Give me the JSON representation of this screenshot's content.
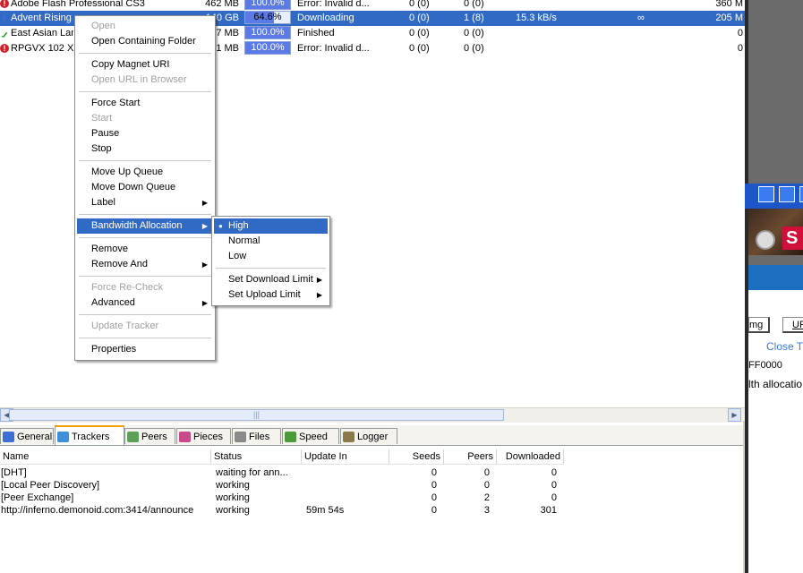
{
  "torrents": [
    {
      "name": "Adobe Flash Professional CS3",
      "size": "462 MB",
      "done": "100.0%",
      "done_pct": 100,
      "status": "Error: Invalid d...",
      "seeds": "0 (0)",
      "peers": "0 (0)",
      "speed": "",
      "eta": "",
      "uploaded": "360 M",
      "icon": "error-icon",
      "icon_glyph": "!"
    },
    {
      "name": "Advent Rising",
      "size": "140 GB",
      "done": "64.6%",
      "done_pct": 64.6,
      "status": "Downloading",
      "seeds": "0 (0)",
      "peers": "1 (8)",
      "speed": "15.3 kB/s",
      "eta": "∞",
      "uploaded": "205 M",
      "icon": "download-arrow-icon",
      "icon_glyph": "⬇",
      "selected": true
    },
    {
      "name": "East Asian Lan",
      "size": "17 MB",
      "done": "100.0%",
      "done_pct": 100,
      "status": "Finished",
      "seeds": "0 (0)",
      "peers": "0 (0)",
      "speed": "",
      "eta": "",
      "uploaded": "0",
      "icon": "checkmark-icon",
      "icon_glyph": "✓"
    },
    {
      "name": "RPGVX 102 XW",
      "size": ".1 MB",
      "done": "100.0%",
      "done_pct": 100,
      "status": "Error: Invalid d...",
      "seeds": "0 (0)",
      "peers": "0 (0)",
      "speed": "",
      "eta": "",
      "uploaded": "0",
      "icon": "error-icon",
      "icon_glyph": "!"
    }
  ],
  "context_menu": {
    "items": [
      {
        "label": "Open",
        "enabled": false
      },
      {
        "label": "Open Containing Folder",
        "enabled": true
      },
      {
        "sep": true
      },
      {
        "label": "Copy Magnet URI",
        "enabled": true
      },
      {
        "label": "Open URL in Browser",
        "enabled": false
      },
      {
        "sep": true
      },
      {
        "label": "Force Start",
        "enabled": true
      },
      {
        "label": "Start",
        "enabled": false
      },
      {
        "label": "Pause",
        "enabled": true
      },
      {
        "label": "Stop",
        "enabled": true
      },
      {
        "sep": true
      },
      {
        "label": "Move Up Queue",
        "enabled": true
      },
      {
        "label": "Move Down Queue",
        "enabled": true
      },
      {
        "label": "Label",
        "enabled": true,
        "submenu": true
      },
      {
        "sep": true
      },
      {
        "label": "Bandwidth Allocation",
        "enabled": true,
        "submenu": true,
        "highlighted": true
      },
      {
        "sep": true
      },
      {
        "label": "Remove",
        "enabled": true
      },
      {
        "label": "Remove And",
        "enabled": true,
        "submenu": true
      },
      {
        "sep": true
      },
      {
        "label": "Force Re-Check",
        "enabled": false
      },
      {
        "label": "Advanced",
        "enabled": true,
        "submenu": true
      },
      {
        "sep": true
      },
      {
        "label": "Update Tracker",
        "enabled": false
      },
      {
        "sep": true
      },
      {
        "label": "Properties",
        "enabled": true
      }
    ]
  },
  "bandwidth_submenu": {
    "items": [
      {
        "label": "High",
        "checked": true,
        "highlighted": true
      },
      {
        "label": "Normal"
      },
      {
        "label": "Low"
      },
      {
        "sep": true
      },
      {
        "label": "Set Download Limit",
        "submenu": true
      },
      {
        "label": "Set Upload Limit",
        "submenu": true
      }
    ]
  },
  "tabs": [
    {
      "label": "General",
      "icon": "info-icon",
      "color": "#3b6fd1"
    },
    {
      "label": "Trackers",
      "icon": "trackers-icon",
      "color": "#3f8fd8",
      "active": true
    },
    {
      "label": "Peers",
      "icon": "peers-icon",
      "color": "#5aa05a"
    },
    {
      "label": "Pieces",
      "icon": "pieces-icon",
      "color": "#c84a8a"
    },
    {
      "label": "Files",
      "icon": "files-icon",
      "color": "#8a8a8a"
    },
    {
      "label": "Speed",
      "icon": "speed-icon",
      "color": "#4a9a3a"
    },
    {
      "label": "Logger",
      "icon": "logger-icon",
      "color": "#8a7a4a"
    }
  ],
  "trackers": {
    "columns": [
      "Name",
      "Status",
      "Update In",
      "Seeds",
      "Peers",
      "Downloaded"
    ],
    "rows": [
      [
        "[DHT]",
        "waiting for ann...",
        "",
        "0",
        "0",
        "0"
      ],
      [
        "[Local Peer Discovery]",
        "working",
        "",
        "0",
        "0",
        "0"
      ],
      [
        "[Peer Exchange]",
        "working",
        "",
        "0",
        "2",
        "0"
      ],
      [
        "http://inferno.demonoid.com:3414/announce",
        "working",
        "59m 54s",
        "0",
        "3",
        "301"
      ]
    ]
  },
  "side_window": {
    "button1": "mg",
    "button2": "UR",
    "link": "Close T",
    "code": "FF0000",
    "text": "lth allocatio"
  }
}
